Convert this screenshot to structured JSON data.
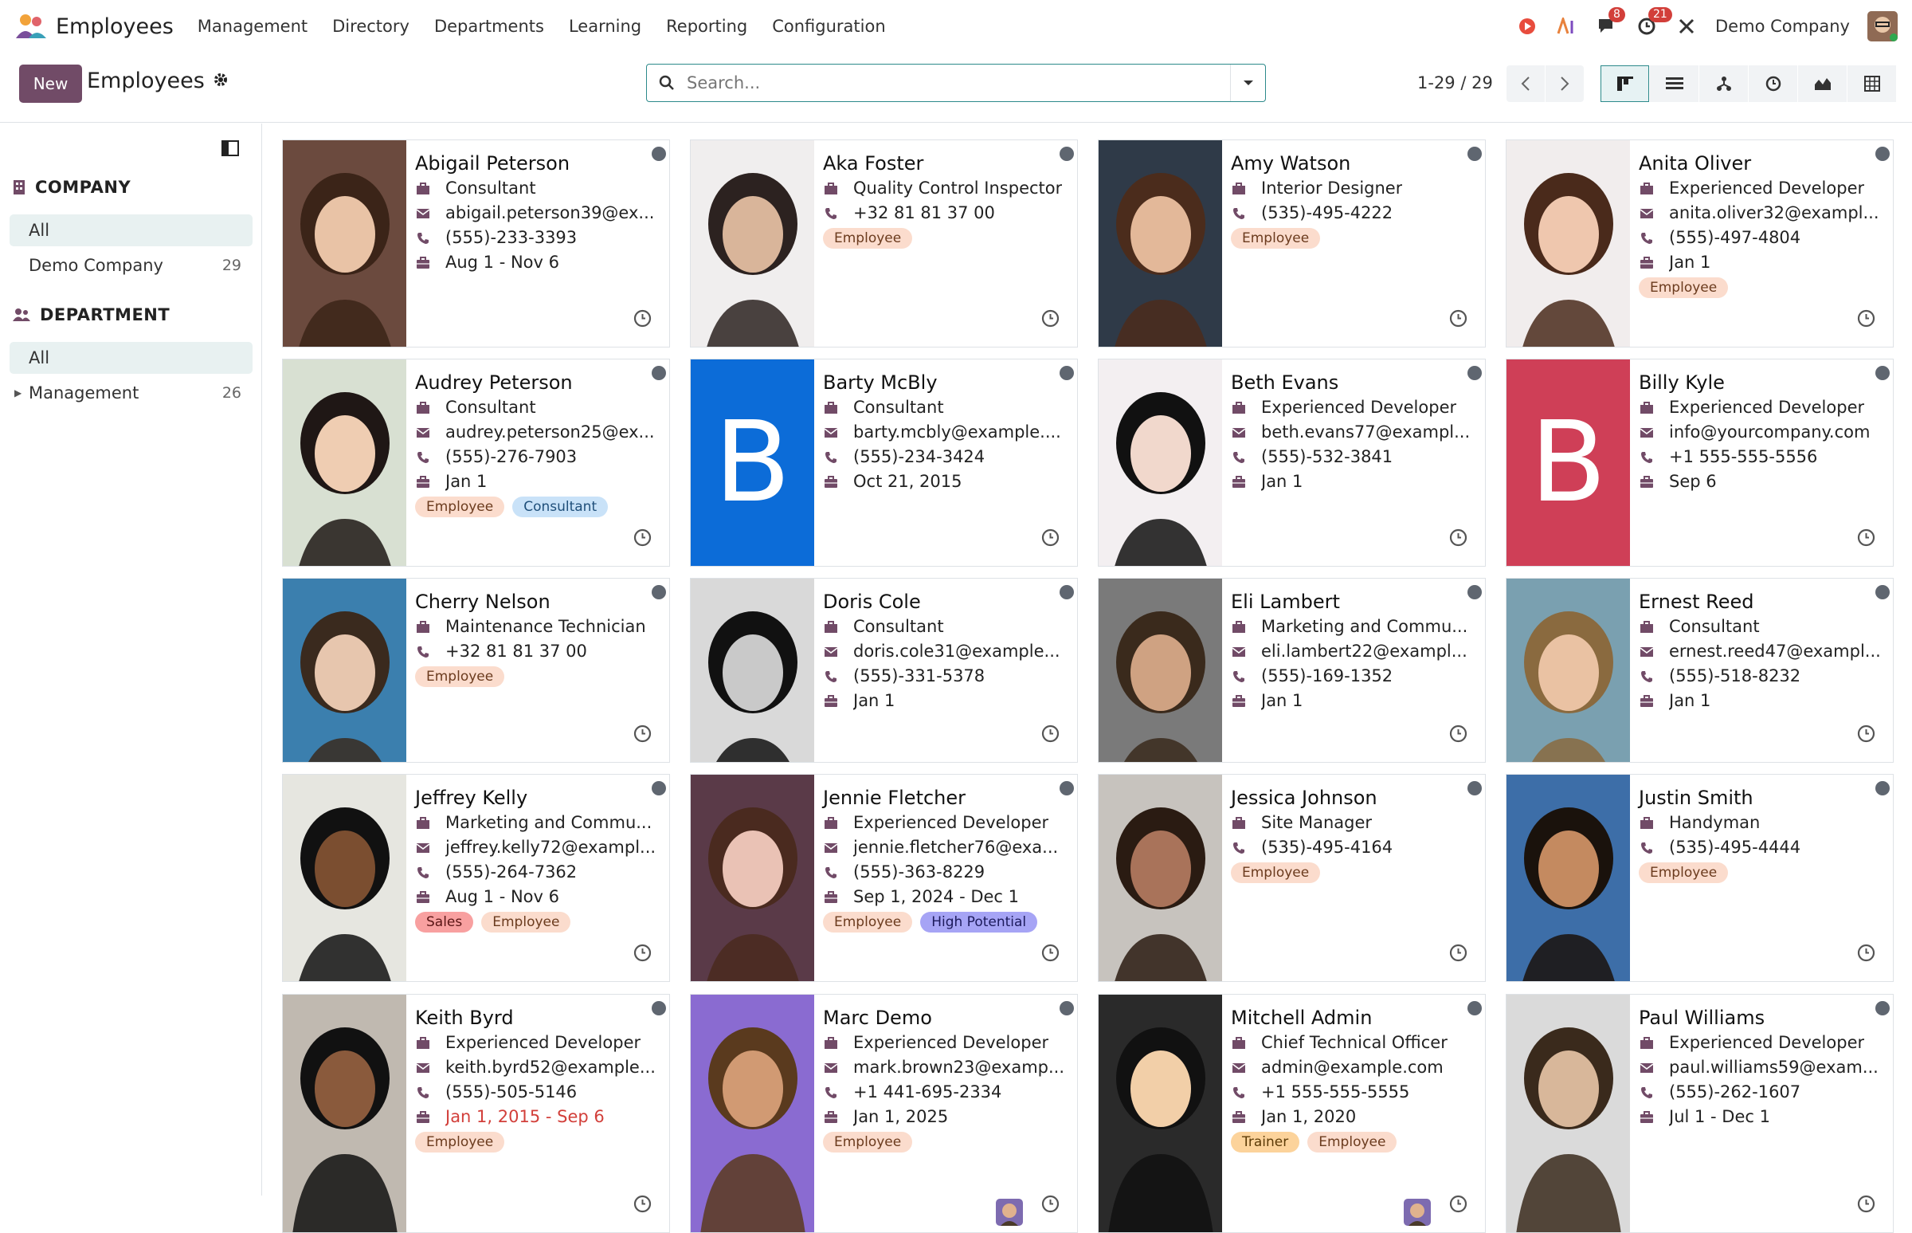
{
  "app": {
    "name": "Employees"
  },
  "menu": [
    "Management",
    "Directory",
    "Departments",
    "Learning",
    "Reporting",
    "Configuration"
  ],
  "systray": {
    "chat_count": "8",
    "activity_count": "21",
    "company": "Demo Company"
  },
  "control": {
    "new_label": "New",
    "breadcrumb": "Employees",
    "search_placeholder": "Search...",
    "pager": "1-29 / 29"
  },
  "sidebar": {
    "company_title": "COMPANY",
    "company_items": [
      {
        "label": "All",
        "count": ""
      },
      {
        "label": "Demo Company",
        "count": "29"
      }
    ],
    "department_title": "DEPARTMENT",
    "department_items": [
      {
        "label": "All",
        "count": ""
      },
      {
        "label": "Management",
        "count": "26"
      }
    ]
  },
  "colors": {
    "primary": "#714b67",
    "accent": "#2d8a8b",
    "tag_employee": "#fbdccd",
    "tag_consultant": "#c9e2f8",
    "tag_sales": "#f8a0a0",
    "tag_high_potential": "#a6a4f5",
    "tag_trainer": "#fcd39b"
  },
  "employees": [
    {
      "name": "Abigail Peterson",
      "lines": [
        [
          "briefcase-icon",
          "Consultant"
        ],
        [
          "envelope-icon",
          "abigail.peterson39@ex..."
        ],
        [
          "phone-icon",
          "(555)-233-3393"
        ],
        [
          "suitcase-icon",
          "Aug 1 - Nov 6"
        ]
      ],
      "tags": []
    },
    {
      "name": "Aka Foster",
      "lines": [
        [
          "briefcase-icon",
          "Quality Control Inspector"
        ],
        [
          "phone-icon",
          "+32 81 81 37 00"
        ]
      ],
      "tags": [
        "Employee"
      ]
    },
    {
      "name": "Amy Watson",
      "lines": [
        [
          "briefcase-icon",
          "Interior Designer"
        ],
        [
          "phone-icon",
          "(535)-495-4222"
        ]
      ],
      "tags": [
        "Employee"
      ]
    },
    {
      "name": "Anita Oliver",
      "lines": [
        [
          "briefcase-icon",
          "Experienced Developer"
        ],
        [
          "envelope-icon",
          "anita.oliver32@exampl..."
        ],
        [
          "phone-icon",
          "(555)-497-4804"
        ],
        [
          "suitcase-icon",
          "Jan 1"
        ]
      ],
      "tags": [
        "Employee"
      ]
    },
    {
      "name": "Audrey Peterson",
      "lines": [
        [
          "briefcase-icon",
          "Consultant"
        ],
        [
          "envelope-icon",
          "audrey.peterson25@ex..."
        ],
        [
          "phone-icon",
          "(555)-276-7903"
        ],
        [
          "suitcase-icon",
          "Jan 1"
        ]
      ],
      "tags": [
        "Employee",
        "Consultant"
      ]
    },
    {
      "name": "Barty McBly",
      "lines": [
        [
          "briefcase-icon",
          "Consultant"
        ],
        [
          "envelope-icon",
          "barty.mcbly@example...."
        ],
        [
          "phone-icon",
          "(555)-234-3424"
        ],
        [
          "suitcase-icon",
          "Oct 21, 2015"
        ]
      ],
      "tags": []
    },
    {
      "name": "Beth Evans",
      "lines": [
        [
          "briefcase-icon",
          "Experienced Developer"
        ],
        [
          "envelope-icon",
          "beth.evans77@exampl..."
        ],
        [
          "phone-icon",
          "(555)-532-3841"
        ],
        [
          "suitcase-icon",
          "Jan 1"
        ]
      ],
      "tags": []
    },
    {
      "name": "Billy Kyle",
      "lines": [
        [
          "briefcase-icon",
          "Experienced Developer"
        ],
        [
          "envelope-icon",
          "info@yourcompany.com"
        ],
        [
          "phone-icon",
          "+1 555-555-5556"
        ],
        [
          "suitcase-icon",
          "Sep 6"
        ]
      ],
      "tags": []
    },
    {
      "name": "Cherry Nelson",
      "lines": [
        [
          "briefcase-icon",
          "Maintenance Technician"
        ],
        [
          "phone-icon",
          "+32 81 81 37 00"
        ]
      ],
      "tags": [
        "Employee"
      ]
    },
    {
      "name": "Doris Cole",
      "lines": [
        [
          "briefcase-icon",
          "Consultant"
        ],
        [
          "envelope-icon",
          "doris.cole31@example..."
        ],
        [
          "phone-icon",
          "(555)-331-5378"
        ],
        [
          "suitcase-icon",
          "Jan 1"
        ]
      ],
      "tags": []
    },
    {
      "name": "Eli Lambert",
      "lines": [
        [
          "briefcase-icon",
          "Marketing and Commu..."
        ],
        [
          "envelope-icon",
          "eli.lambert22@exampl..."
        ],
        [
          "phone-icon",
          "(555)-169-1352"
        ],
        [
          "suitcase-icon",
          "Jan 1"
        ]
      ],
      "tags": []
    },
    {
      "name": "Ernest Reed",
      "lines": [
        [
          "briefcase-icon",
          "Consultant"
        ],
        [
          "envelope-icon",
          "ernest.reed47@exampl..."
        ],
        [
          "phone-icon",
          "(555)-518-8232"
        ],
        [
          "suitcase-icon",
          "Jan 1"
        ]
      ],
      "tags": []
    },
    {
      "name": "Jeffrey Kelly",
      "lines": [
        [
          "briefcase-icon",
          "Marketing and Commu..."
        ],
        [
          "envelope-icon",
          "jeffrey.kelly72@exampl..."
        ],
        [
          "phone-icon",
          "(555)-264-7362"
        ],
        [
          "suitcase-icon",
          "Aug 1 - Nov 6"
        ]
      ],
      "tags": [
        "Sales",
        "Employee"
      ]
    },
    {
      "name": "Jennie Fletcher",
      "lines": [
        [
          "briefcase-icon",
          "Experienced Developer"
        ],
        [
          "envelope-icon",
          "jennie.fletcher76@exa..."
        ],
        [
          "phone-icon",
          "(555)-363-8229"
        ],
        [
          "suitcase-icon",
          "Sep 1, 2024 - Dec 1"
        ]
      ],
      "tags": [
        "Employee",
        "High Potential"
      ]
    },
    {
      "name": "Jessica Johnson",
      "lines": [
        [
          "briefcase-icon",
          "Site Manager"
        ],
        [
          "phone-icon",
          "(535)-495-4164"
        ]
      ],
      "tags": [
        "Employee"
      ]
    },
    {
      "name": "Justin Smith",
      "lines": [
        [
          "briefcase-icon",
          "Handyman"
        ],
        [
          "phone-icon",
          "(535)-495-4444"
        ]
      ],
      "tags": [
        "Employee"
      ]
    },
    {
      "name": "Keith Byrd",
      "lines": [
        [
          "briefcase-icon",
          "Experienced Developer"
        ],
        [
          "envelope-icon",
          "keith.byrd52@example..."
        ],
        [
          "phone-icon",
          "(555)-505-5146"
        ],
        [
          "suitcase-icon",
          "Jan 1, 2015 - Sep 6"
        ]
      ],
      "tags": [
        "Employee"
      ],
      "date_red": true
    },
    {
      "name": "Marc Demo",
      "lines": [
        [
          "briefcase-icon",
          "Experienced Developer"
        ],
        [
          "envelope-icon",
          "mark.brown23@examp..."
        ],
        [
          "phone-icon",
          "+1 441-695-2334"
        ],
        [
          "suitcase-icon",
          "Jan 1, 2025"
        ]
      ],
      "tags": [
        "Employee"
      ],
      "mini_avatar": true
    },
    {
      "name": "Mitchell Admin",
      "lines": [
        [
          "briefcase-icon",
          "Chief Technical Officer"
        ],
        [
          "envelope-icon",
          "admin@example.com"
        ],
        [
          "phone-icon",
          "+1 555-555-5555"
        ],
        [
          "suitcase-icon",
          "Jan 1, 2020"
        ]
      ],
      "tags": [
        "Trainer",
        "Employee"
      ],
      "mini_avatar": true
    },
    {
      "name": "Paul Williams",
      "lines": [
        [
          "briefcase-icon",
          "Experienced Developer"
        ],
        [
          "envelope-icon",
          "paul.williams59@exam..."
        ],
        [
          "phone-icon",
          "(555)-262-1607"
        ],
        [
          "suitcase-icon",
          "Jul 1 - Dec 1"
        ]
      ],
      "tags": []
    }
  ]
}
